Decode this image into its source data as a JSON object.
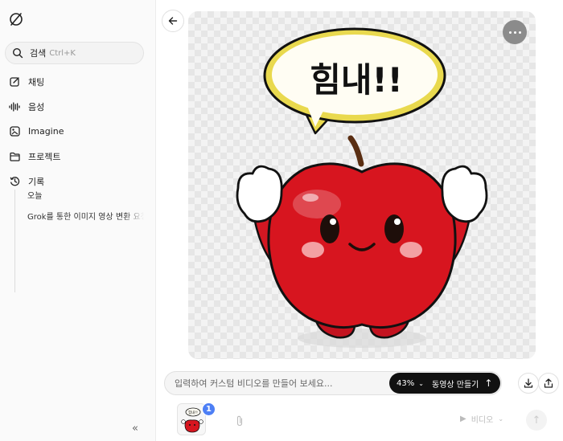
{
  "sidebar": {
    "search": {
      "label": "검색",
      "shortcut": "Ctrl+K"
    },
    "items": [
      {
        "icon": "pencil-square-icon",
        "label": "채팅"
      },
      {
        "icon": "audio-wave-icon",
        "label": "음성"
      },
      {
        "icon": "image-sparkle-icon",
        "label": "Imagine"
      },
      {
        "icon": "folder-icon",
        "label": "프로젝트"
      },
      {
        "icon": "history-clock-icon",
        "label": "기록"
      }
    ],
    "history": {
      "day": "오늘",
      "chats": [
        "Grok를 통한 이미지 영상 변환 요청"
      ]
    },
    "collapse_glyph": "«"
  },
  "image": {
    "speech_bubble_text": "힘내!!",
    "bubble_fill": "#fffdf3",
    "bubble_stroke": "#f1e04f",
    "apple_color": "#d7151f",
    "cheek_color": "#f3a0a3"
  },
  "prompt": {
    "placeholder": "입력하여 커스텀 비디오를 만들어 보세요...",
    "percent": "43%",
    "generate_label": "동영상 만들기"
  },
  "composer": {
    "thumb_badge": "1",
    "thumb_bubble_text": "힘내!!",
    "mode_label": "비디오"
  },
  "colors": {
    "accent_badge": "#4d7ff5",
    "dark_pill": "#111111"
  }
}
